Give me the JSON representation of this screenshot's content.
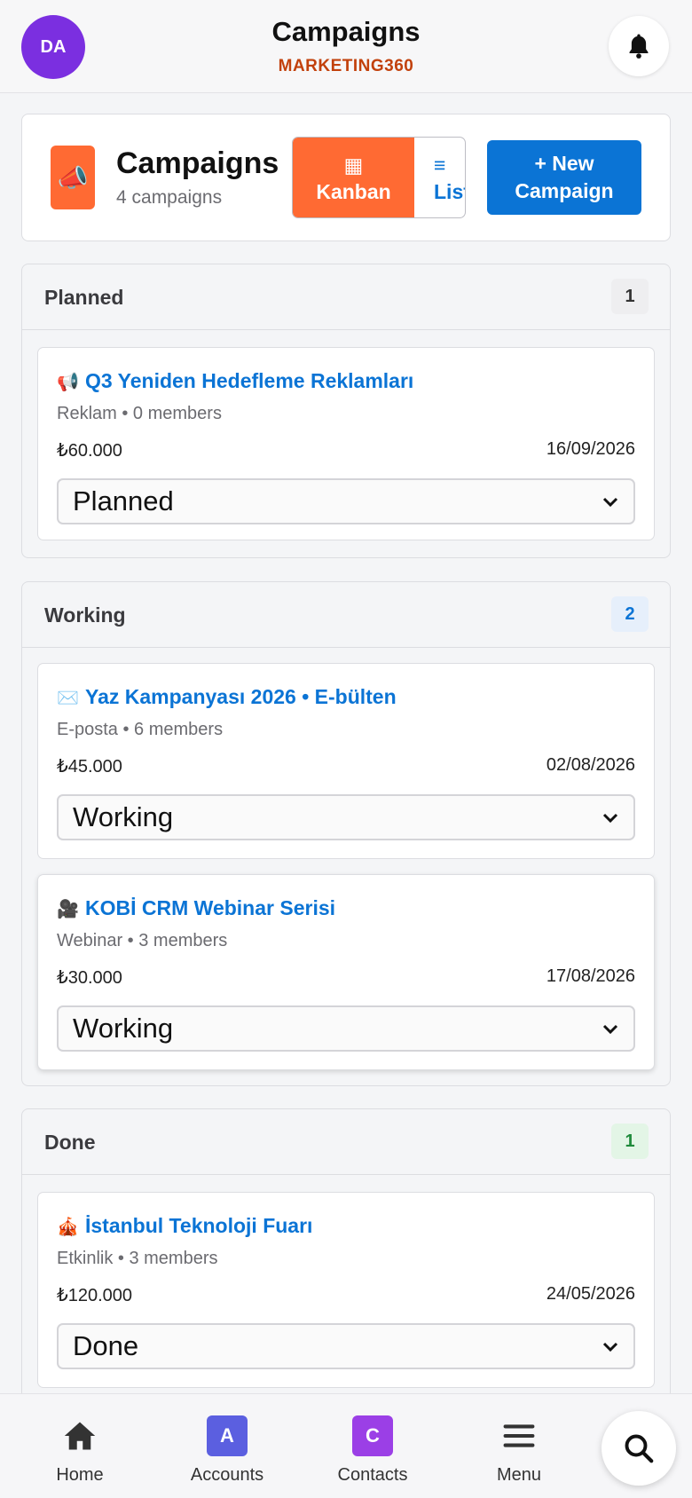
{
  "topbar": {
    "avatar_initials": "DA",
    "title": "Campaigns",
    "subtitle": "MARKETING360",
    "bell_icon": "bell-icon"
  },
  "header": {
    "icon": "megaphone-icon",
    "icon_glyph": "📣",
    "title": "Campaigns",
    "subtitle": "4 campaigns",
    "view_toggle": {
      "kanban_icon": "▦",
      "kanban_label": "Kanban",
      "list_icon": "≡",
      "list_label": "List"
    },
    "new_button_line1": "+ New",
    "new_button_line2": "Campaign"
  },
  "columns": [
    {
      "title": "Planned",
      "count": "1",
      "cards": [
        {
          "emoji": "📢",
          "title": "Q3 Yeniden Hedefleme Reklamları",
          "meta": "Reklam • 0 members",
          "budget": "₺60.000",
          "date": "16/09/2026",
          "status": "Planned"
        }
      ]
    },
    {
      "title": "Working",
      "count": "2",
      "cards": [
        {
          "emoji": "✉️",
          "title": "Yaz Kampanyası 2026 • E-bülten",
          "meta": "E-posta • 6 members",
          "budget": "₺45.000",
          "date": "02/08/2026",
          "status": "Working"
        },
        {
          "emoji": "🎥",
          "title": "KOBİ CRM Webinar Serisi",
          "meta": "Webinar • 3 members",
          "budget": "₺30.000",
          "date": "17/08/2026",
          "status": "Working"
        }
      ]
    },
    {
      "title": "Done",
      "count": "1",
      "cards": [
        {
          "emoji": "🎪",
          "title": "İstanbul Teknoloji Fuarı",
          "meta": "Etkinlik • 3 members",
          "budget": "₺120.000",
          "date": "24/05/2026",
          "status": "Done"
        }
      ]
    }
  ],
  "bottom_nav": {
    "home": "Home",
    "accounts": "Accounts",
    "accounts_badge": "A",
    "contacts": "Contacts",
    "contacts_badge": "C",
    "menu": "Menu"
  },
  "colors": {
    "accent_orange": "#ff6a33",
    "primary_blue": "#0b74d5",
    "avatar_purple": "#7b2fe0",
    "accounts_badge": "#5b5fe0",
    "contacts_badge": "#9b3fe6"
  }
}
